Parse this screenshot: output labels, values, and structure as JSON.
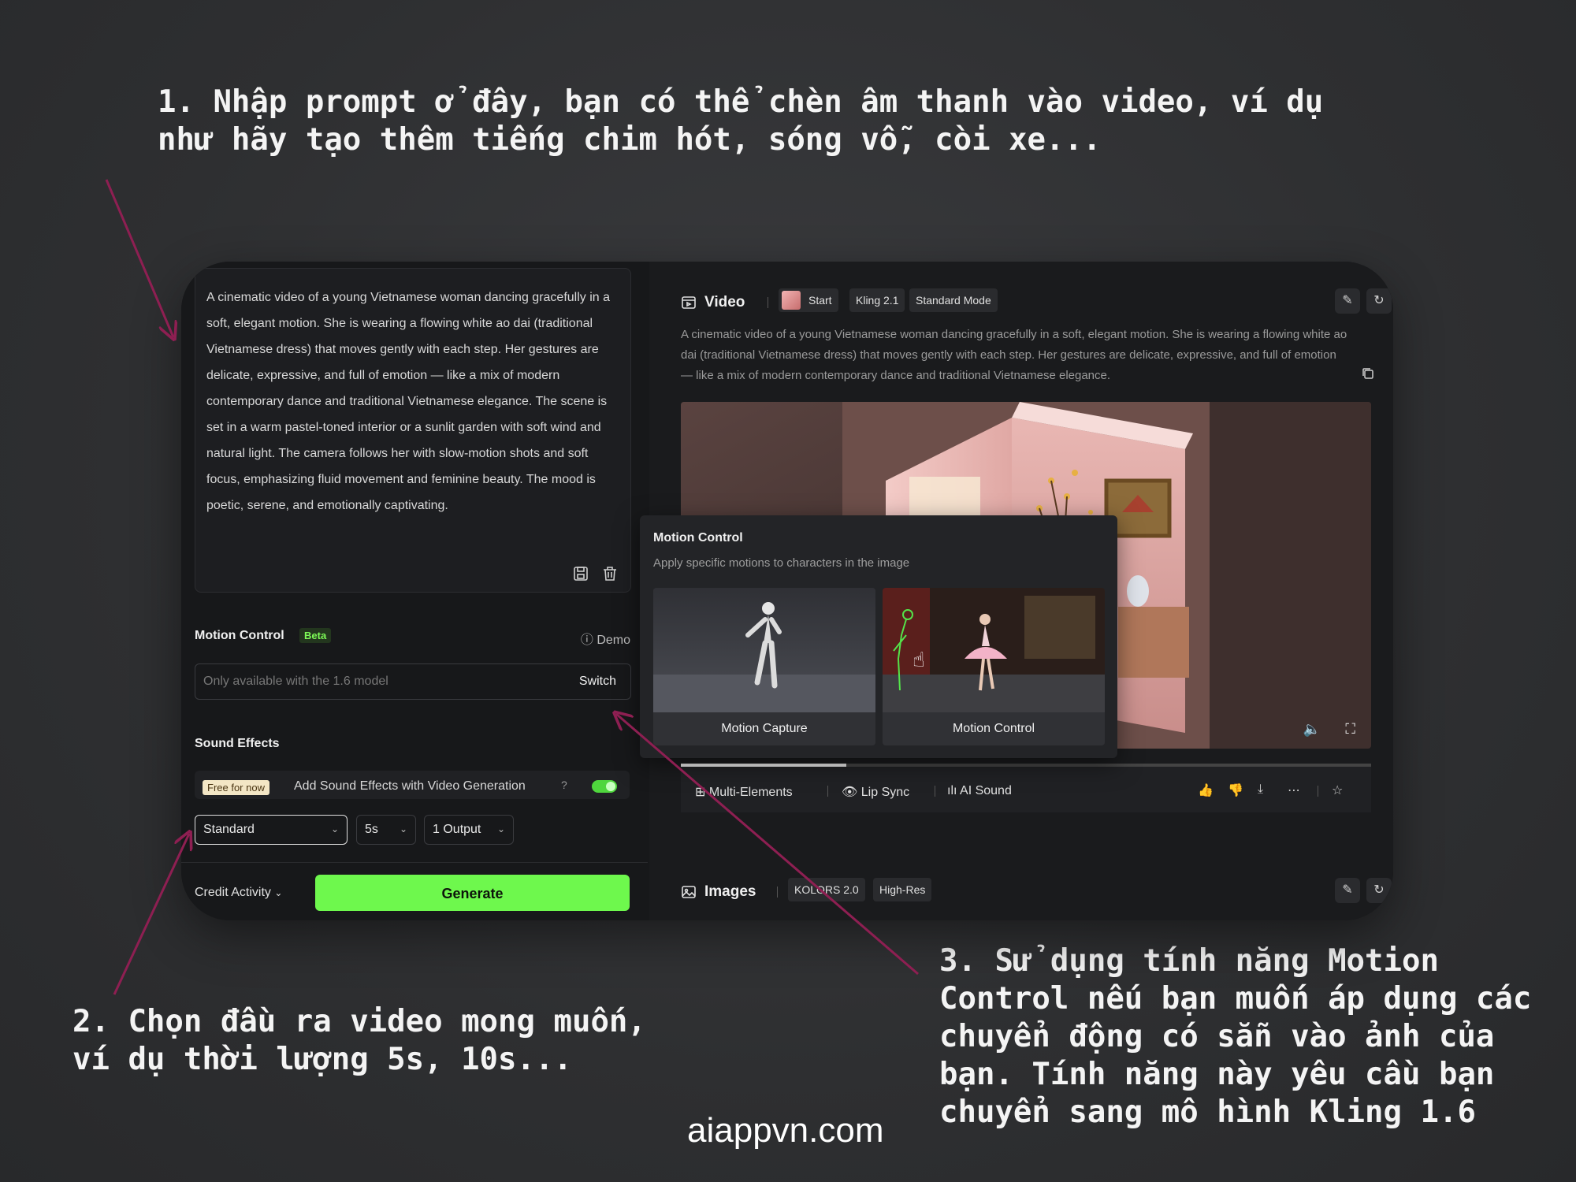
{
  "annotations": {
    "a1": "1. Nhập prompt ở đây, bạn có thể chèn âm thanh vào video, ví dụ như hãy tạo thêm tiếng chim hót, sóng vỗ, còi xe...",
    "a2": "2. Chọn đầu ra video mong muốn, ví dụ thời lượng 5s, 10s...",
    "a3": "3. Sử dụng tính năng Motion Control nếu bạn muốn áp dụng các chuyển động có sẵn vào ảnh của bạn. Tính năng này yêu cầu bạn chuyển sang mô hình Kling 1.6",
    "watermark": "aiappvn.com"
  },
  "left": {
    "prompt": "A cinematic video of a young Vietnamese woman dancing gracefully in a soft, elegant motion. She is wearing a flowing white ao dai (traditional Vietnamese dress) that moves gently with each step. Her gestures are delicate, expressive, and full of emotion — like a mix of modern contemporary dance and traditional Vietnamese elegance. The scene is set in a warm pastel-toned interior or a sunlit garden with soft wind and natural light. The camera follows her with slow-motion shots and soft focus, emphasizing fluid movement and feminine beauty. The mood is poetic, serene, and emotionally captivating.",
    "motion_control_label": "Motion Control",
    "beta_badge": "Beta",
    "demo_label": "Demo",
    "model_placeholder": "Only available with the 1.6 model",
    "switch_label": "Switch",
    "sound_effects_label": "Sound Effects",
    "free_badge": "Free for now",
    "sound_effects_text": "Add Sound Effects with Video Generation",
    "sound_effects_on": true,
    "mode_select": "Standard",
    "duration_select": "5s",
    "output_select": "1 Output",
    "credit_label": "Credit Activity",
    "generate_label": "Generate"
  },
  "right": {
    "video_title": "Video",
    "video_chips": [
      "Start",
      "Kling 2.1",
      "Standard Mode"
    ],
    "video_description": "A cinematic video of a young Vietnamese woman dancing gracefully in a soft, elegant motion. She is wearing a flowing white ao dai (traditional Vietnamese dress) that moves gently with each step. Her gestures are delicate, expressive, and full of emotion — like a mix of modern contemporary dance and traditional Vietnamese elegance.",
    "progress": 0.24,
    "tools": [
      "Multi-Elements",
      "Lip Sync",
      "AI Sound"
    ],
    "images_title": "Images",
    "images_chips": [
      "KOLORS 2.0",
      "High-Res"
    ]
  },
  "popup": {
    "title": "Motion Control",
    "subtitle": "Apply specific motions to characters in the image",
    "cards": [
      "Motion Capture",
      "Motion Control"
    ]
  },
  "colors": {
    "accent_green": "#6ef84d",
    "arrow": "#8e1f52",
    "panel_bg": "#17181a"
  }
}
